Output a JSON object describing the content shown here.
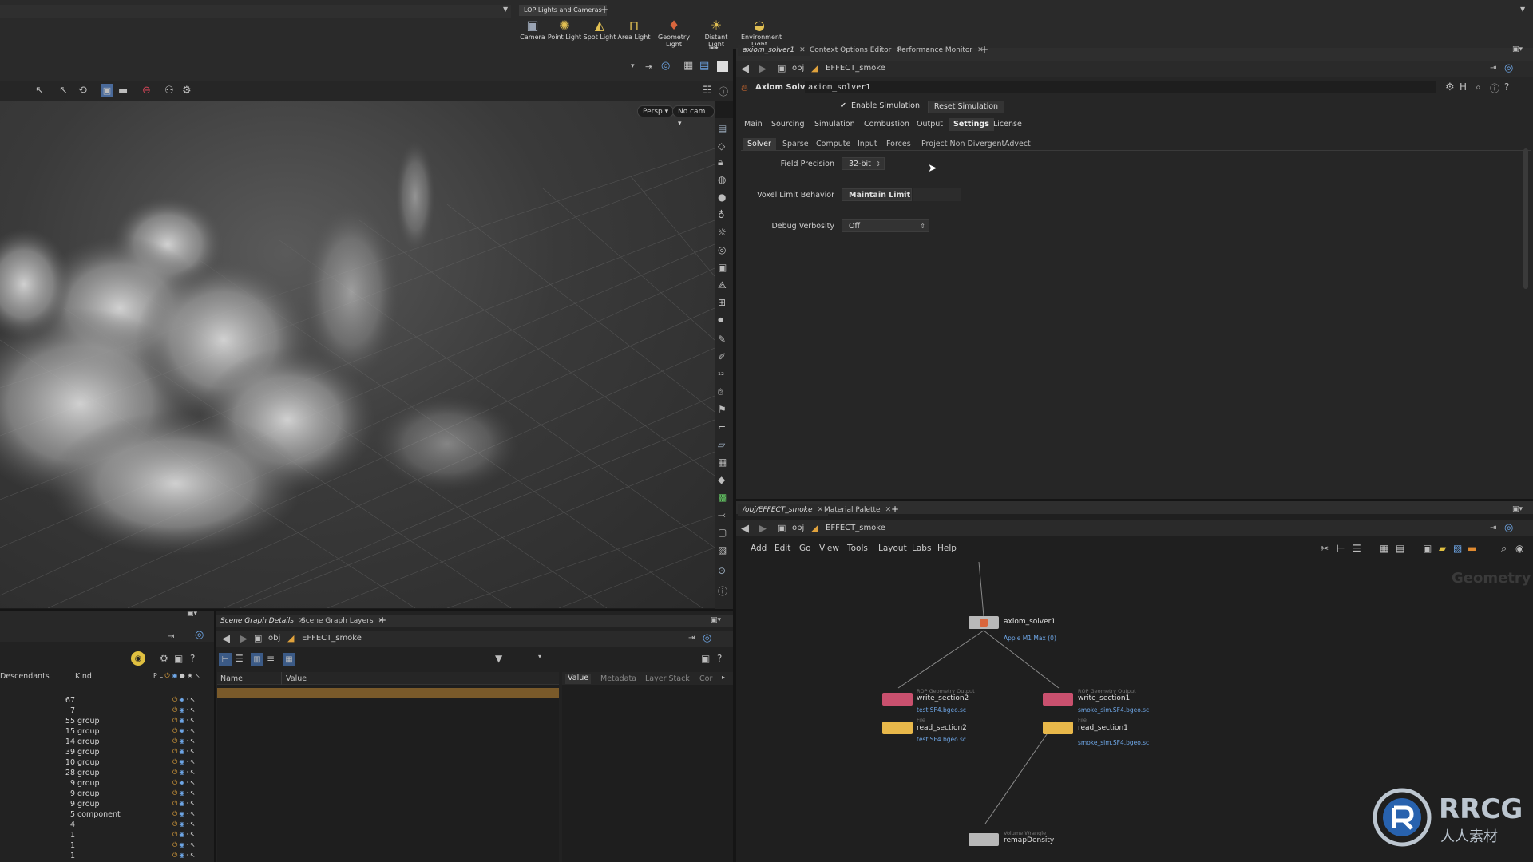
{
  "shelf": {
    "tab_label": "LOP Lights and Cameras",
    "tools": [
      {
        "label": "Camera",
        "icon": "camera-icon"
      },
      {
        "label": "Point Light",
        "icon": "point-light-icon"
      },
      {
        "label": "Spot Light",
        "icon": "spot-light-icon"
      },
      {
        "label": "Area Light",
        "icon": "area-light-icon"
      },
      {
        "label": "Geometry Light",
        "icon": "geometry-light-icon"
      },
      {
        "label": "Distant Light",
        "icon": "distant-light-icon"
      },
      {
        "label": "Environment Light",
        "icon": "environment-light-icon"
      }
    ]
  },
  "viewport": {
    "persp_label": "Persp",
    "cam_label": "No cam"
  },
  "param_pane": {
    "tabs": [
      {
        "label": "axiom_solver1",
        "active": true
      },
      {
        "label": "Context Options Editor",
        "active": false
      },
      {
        "label": "Performance Monitor",
        "active": false
      }
    ],
    "path_obj": "obj",
    "path_node": "EFFECT_smoke",
    "node_type": "Axiom Solver",
    "node_name": "axiom_solver1",
    "enable_simulation": "Enable Simulation",
    "reset_simulation": "Reset Simulation",
    "main_tabs": [
      {
        "label": "Main",
        "selected": false
      },
      {
        "label": "Sourcing",
        "selected": false
      },
      {
        "label": "Simulation",
        "selected": false
      },
      {
        "label": "Combustion",
        "selected": false
      },
      {
        "label": "Output",
        "selected": false
      },
      {
        "label": "Settings",
        "selected": true
      },
      {
        "label": "License",
        "selected": false
      }
    ],
    "sub_tabs": [
      {
        "label": "Solver",
        "selected": true
      },
      {
        "label": "Sparse",
        "selected": false
      },
      {
        "label": "Compute",
        "selected": false
      },
      {
        "label": "Input",
        "selected": false
      },
      {
        "label": "Forces",
        "selected": false
      },
      {
        "label": "Project Non Divergent",
        "selected": false
      },
      {
        "label": "Advect",
        "selected": false
      }
    ],
    "field_precision_label": "Field Precision",
    "field_precision_value": "32-bit",
    "voxel_limit_label": "Voxel Limit Behavior",
    "voxel_limit_value": "Maintain Limit",
    "debug_verbosity_label": "Debug Verbosity",
    "debug_verbosity_value": "Off"
  },
  "network_pane": {
    "tabs": [
      {
        "label": "/obj/EFFECT_smoke",
        "active": true
      },
      {
        "label": "Material Palette",
        "active": false
      }
    ],
    "path_obj": "obj",
    "path_node": "EFFECT_smoke",
    "menu": [
      "Add",
      "Edit",
      "Go",
      "View",
      "Tools",
      "Layout",
      "Labs",
      "Help"
    ],
    "context_label": "Geometry",
    "nodes": {
      "axiom": {
        "name": "axiom_solver1",
        "sub": "Apple M1 Max (0)"
      },
      "write2": {
        "type": "ROP Geometry Output",
        "name": "write_section2",
        "sub": "test.SF4.bgeo.sc"
      },
      "write1": {
        "type": "ROP Geometry Output",
        "name": "write_section1",
        "sub": "smoke_sim.SF4.bgeo.sc"
      },
      "read2": {
        "type": "File",
        "name": "read_section2",
        "sub": "test.SF4.bgeo.sc"
      },
      "read1": {
        "type": "File",
        "name": "read_section1",
        "sub": "smoke_sim.SF4.bgeo.sc"
      },
      "remap": {
        "type": "Volume Wrangle",
        "name": "remapDensity"
      }
    }
  },
  "scene_graph": {
    "tabs": [
      {
        "label": "Scene Graph Details",
        "active": true
      },
      {
        "label": "Scene Graph Layers",
        "active": false
      }
    ],
    "path_obj": "obj",
    "path_node": "EFFECT_smoke",
    "tree_headers": {
      "descendants": "Descendants",
      "kind": "Kind",
      "flags": "P L"
    },
    "tree_rows": [
      {
        "desc": "67",
        "kind": ""
      },
      {
        "desc": "7",
        "kind": ""
      },
      {
        "desc": "55",
        "kind": "group"
      },
      {
        "desc": "15",
        "kind": "group"
      },
      {
        "desc": "14",
        "kind": "group"
      },
      {
        "desc": "39",
        "kind": "group"
      },
      {
        "desc": "10",
        "kind": "group"
      },
      {
        "desc": "28",
        "kind": "group"
      },
      {
        "desc": "9",
        "kind": "group"
      },
      {
        "desc": "9",
        "kind": "group"
      },
      {
        "desc": "9",
        "kind": "group"
      },
      {
        "desc": "5",
        "kind": "component"
      },
      {
        "desc": "4",
        "kind": ""
      },
      {
        "desc": "1",
        "kind": ""
      },
      {
        "desc": "1",
        "kind": ""
      },
      {
        "desc": "1",
        "kind": ""
      }
    ],
    "details_headers": {
      "name": "Name",
      "value": "Value"
    },
    "right_tabs": [
      "Value",
      "Metadata",
      "Layer Stack",
      "Cor"
    ]
  },
  "watermark": {
    "brand": "RRCG",
    "sub": "人人素材"
  },
  "colors": {
    "accent_orange": "#e0a23c",
    "link_blue": "#6ea6e6",
    "rop_node": "#c9506e",
    "file_node": "#e8b84a",
    "grey_node": "#b8b8b8",
    "selected_row": "#7a5a2a"
  }
}
